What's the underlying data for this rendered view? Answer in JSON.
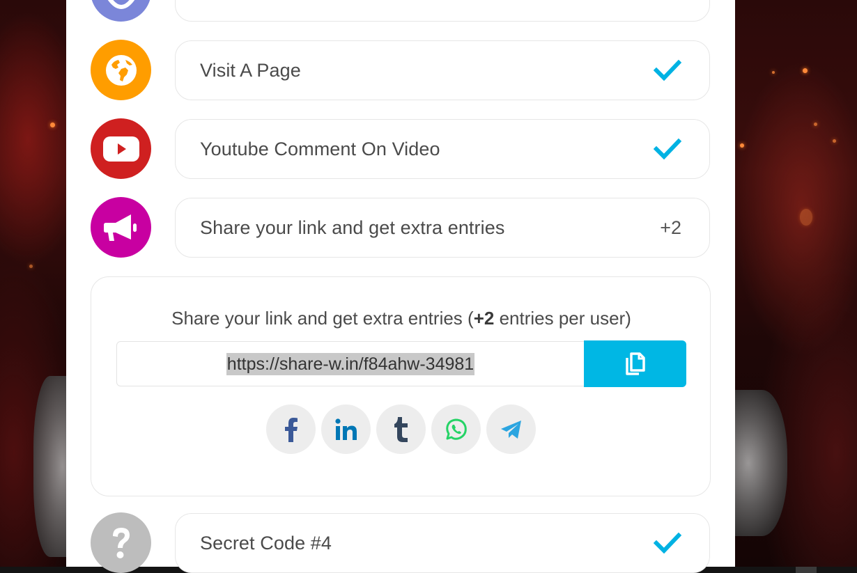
{
  "tasks": [
    {
      "id": "top-partial",
      "label": "",
      "status": "",
      "color": "#7b86d9",
      "icon": "partial-icon"
    },
    {
      "id": "visit-page",
      "label": "Visit A Page",
      "status": "check",
      "color": "#ff9d00",
      "icon": "globe-icon"
    },
    {
      "id": "youtube-comment",
      "label": "Youtube Comment On Video",
      "status": "check",
      "color": "#cf2020",
      "icon": "youtube-icon"
    },
    {
      "id": "share-link",
      "label": "Share your link and get extra entries",
      "status": "+2",
      "color": "#c800a1",
      "icon": "megaphone-icon"
    },
    {
      "id": "secret-code",
      "label": "Secret Code #4",
      "status": "check",
      "color": "#bdbdbd",
      "icon": "question-icon"
    }
  ],
  "share": {
    "title_prefix": "Share your link and get extra entries (",
    "title_bold": "+2",
    "title_suffix": " entries per user)",
    "link": "https://share-w.in/f84ahw-34981",
    "copy_icon": "copy-icon",
    "socials": [
      {
        "name": "facebook",
        "icon": "facebook-icon",
        "color": "#3b5998"
      },
      {
        "name": "linkedin",
        "icon": "linkedin-icon",
        "color": "#0077b5"
      },
      {
        "name": "tumblr",
        "icon": "tumblr-icon",
        "color": "#34465d"
      },
      {
        "name": "whatsapp",
        "icon": "whatsapp-icon",
        "color": "#25d366"
      },
      {
        "name": "telegram",
        "icon": "telegram-icon",
        "color": "#2ca5e0"
      }
    ]
  },
  "colors": {
    "accent": "#00b7e4",
    "check": "#00b2e3"
  }
}
